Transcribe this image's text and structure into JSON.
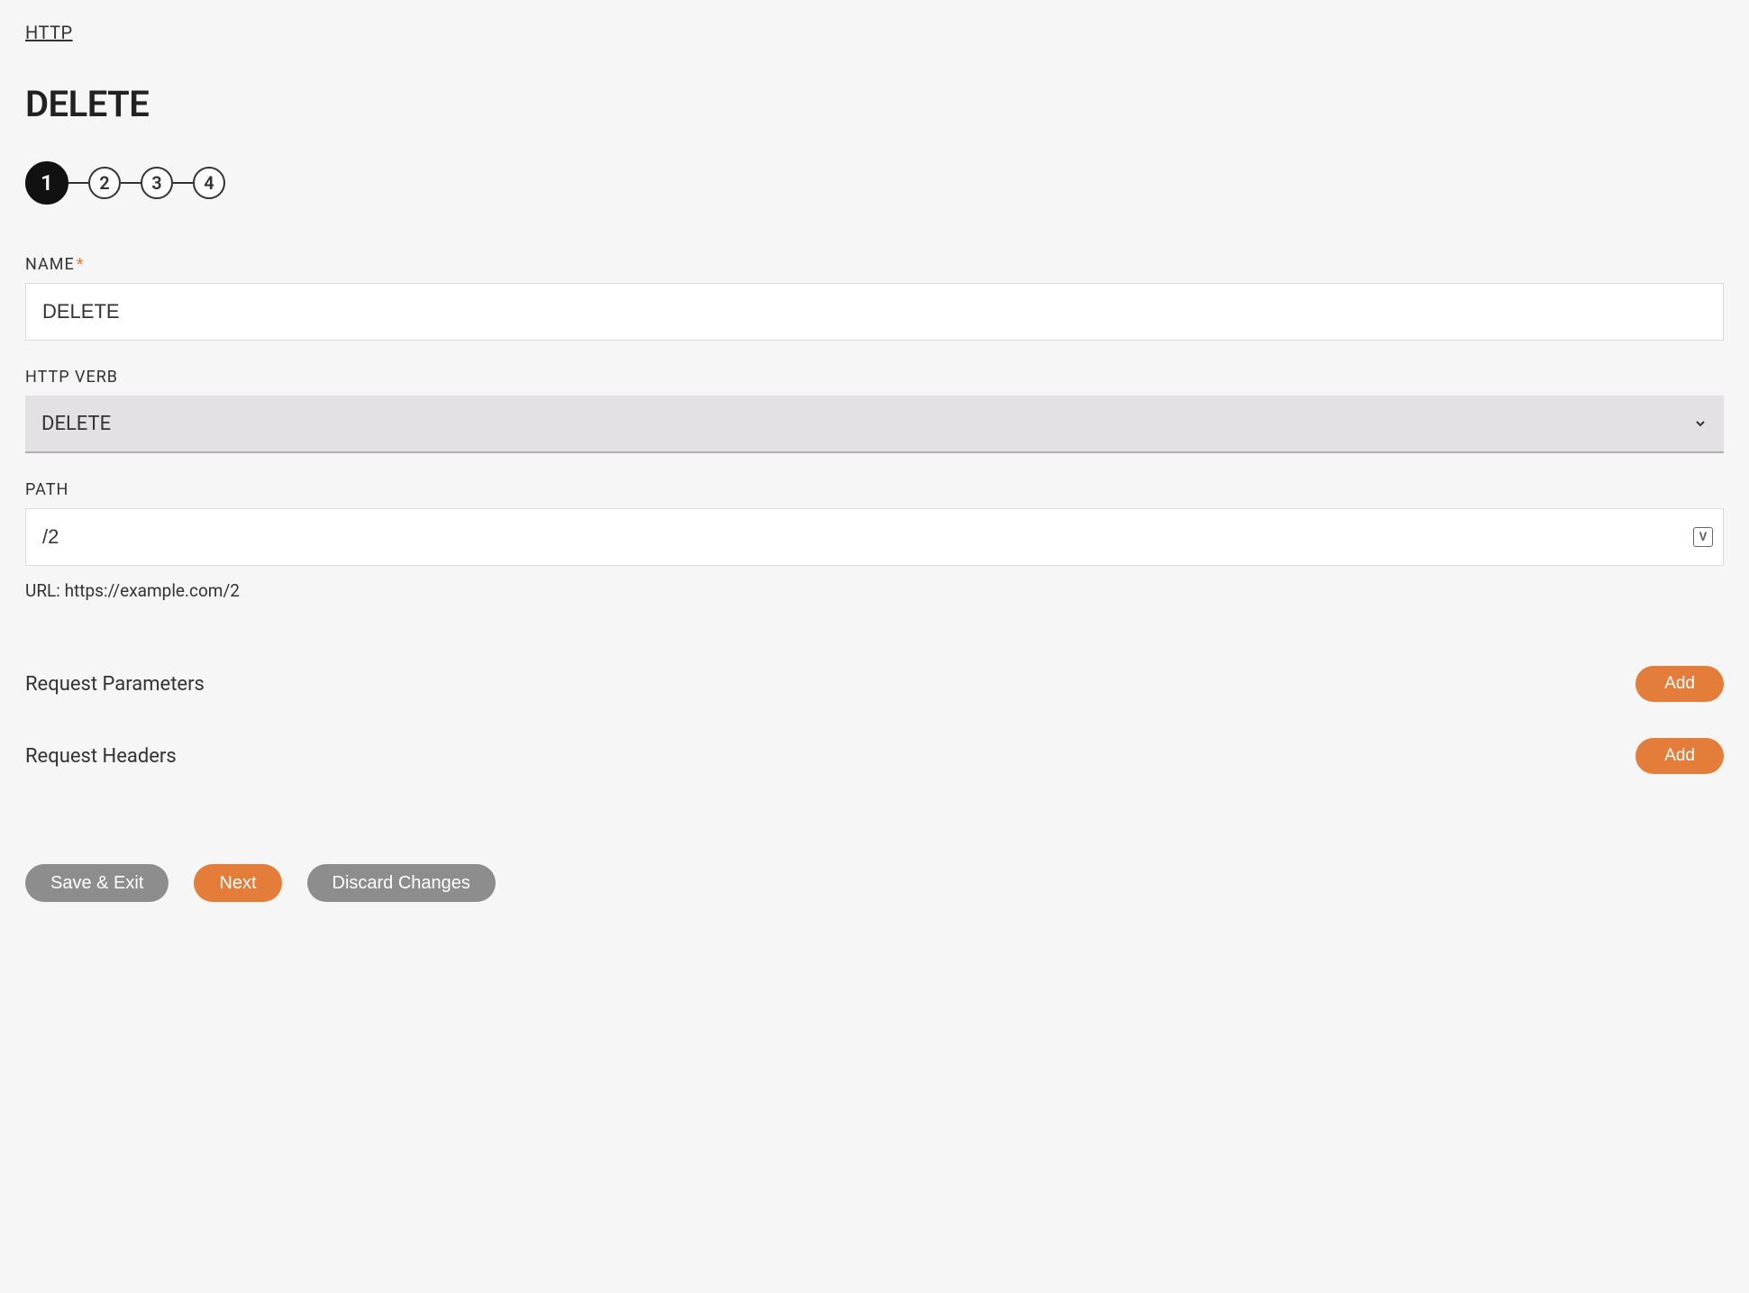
{
  "breadcrumb": "HTTP",
  "title": "DELETE",
  "steps": [
    "1",
    "2",
    "3",
    "4"
  ],
  "activeStep": 0,
  "fields": {
    "name": {
      "label": "NAME",
      "value": "DELETE",
      "required": true
    },
    "verb": {
      "label": "HTTP VERB",
      "value": "DELETE"
    },
    "path": {
      "label": "PATH",
      "value": "/2"
    }
  },
  "urlHint": "URL: https://example.com/2",
  "sections": {
    "params": {
      "title": "Request Parameters",
      "addLabel": "Add"
    },
    "headers": {
      "title": "Request Headers",
      "addLabel": "Add"
    }
  },
  "footer": {
    "saveExit": "Save & Exit",
    "next": "Next",
    "discard": "Discard Changes"
  },
  "varIconLabel": "V"
}
